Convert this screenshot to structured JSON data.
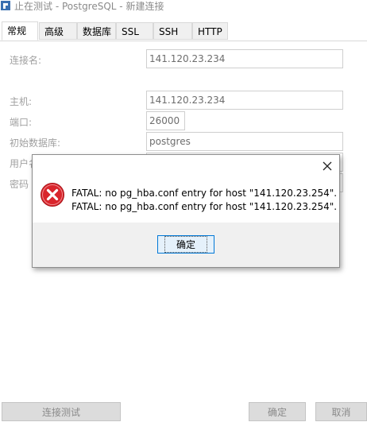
{
  "window": {
    "title": "止在测试 - PostgreSQL - 新建连接",
    "icon": "app-icon"
  },
  "tabs": [
    {
      "label": "常规",
      "active": true
    },
    {
      "label": "高级",
      "active": false
    },
    {
      "label": "数据库",
      "active": false
    },
    {
      "label": "SSL",
      "active": false
    },
    {
      "label": "SSH",
      "active": false
    },
    {
      "label": "HTTP",
      "active": false
    }
  ],
  "form": {
    "connection_name": {
      "label": "连接名:",
      "value": "141.120.23.234"
    },
    "host": {
      "label": "主机:",
      "value": "141.120.23.234"
    },
    "port": {
      "label": "端口:",
      "value": "26000"
    },
    "initial_db": {
      "label": "初始数据库:",
      "value": "postgres"
    },
    "username": {
      "label": "用户名"
    },
    "password": {
      "label": "密码"
    }
  },
  "dialog": {
    "icon": "error-icon",
    "line1": "FATAL:  no pg_hba.conf entry for host \"141.120.23.254\".",
    "line2": "FATAL:  no pg_hba.conf entry for host \"141.120.23.254\".",
    "ok_label": "确定",
    "close_icon": "close-icon"
  },
  "footer": {
    "test_label": "连接测试",
    "ok_label": "确定",
    "cancel_label": "取消"
  },
  "colors": {
    "error_red": "#d9252c",
    "dialog_border": "#8d8d8d",
    "focus_blue": "#0078d7"
  }
}
